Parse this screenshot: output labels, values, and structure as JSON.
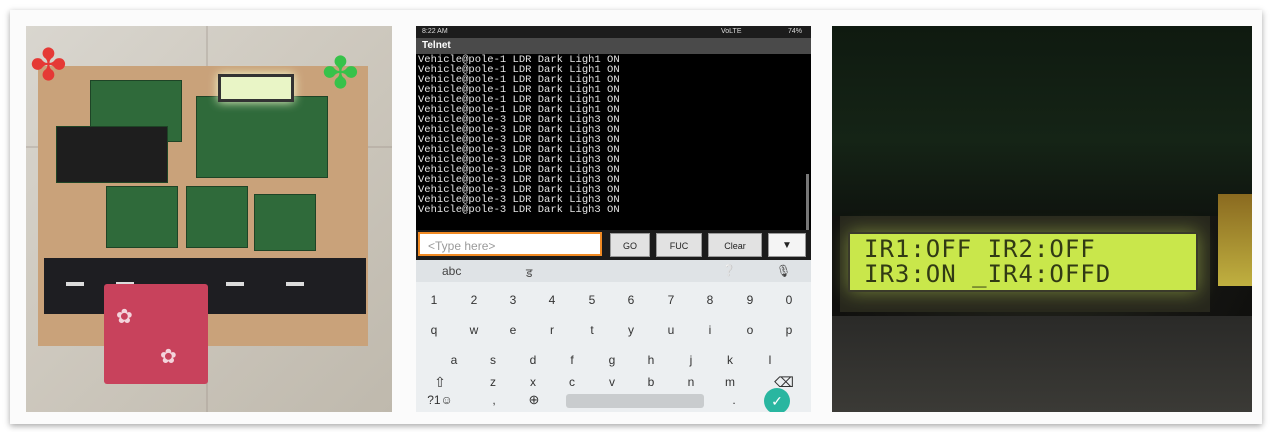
{
  "phone": {
    "status": {
      "time": "8:22 AM",
      "network": "VoLTE",
      "battery": "74%"
    },
    "app_title": "Telnet",
    "console_lines": [
      "Vehicle@pole-1 LDR Dark Ligh1 ON",
      "Vehicle@pole-1 LDR Dark Ligh1 ON",
      "Vehicle@pole-1 LDR Dark Ligh1 ON",
      "Vehicle@pole-1 LDR Dark Ligh1 ON",
      "Vehicle@pole-1 LDR Dark Ligh1 ON",
      "Vehicle@pole-1 LDR Dark Ligh1 ON",
      "Vehicle@pole-3 LDR Dark Ligh3 ON",
      "Vehicle@pole-3 LDR Dark Ligh3 ON",
      "Vehicle@pole-3 LDR Dark Ligh3 ON",
      "Vehicle@pole-3 LDR Dark Ligh3 ON",
      "Vehicle@pole-3 LDR Dark Ligh3 ON",
      "Vehicle@pole-3 LDR Dark Ligh3 ON",
      "Vehicle@pole-3 LDR Dark Ligh3 ON",
      "Vehicle@pole-3 LDR Dark Ligh3 ON",
      "Vehicle@pole-3 LDR Dark Ligh3 ON",
      "Vehicle@pole-3 LDR Dark Ligh3 ON"
    ],
    "input_placeholder": "<Type here>",
    "buttons": {
      "go": "GO",
      "fuc": "FUC",
      "clear": "Clear",
      "menu_icon": "chevron-down-icon"
    },
    "keyboard": {
      "top": {
        "abc": "abc",
        "handwriting": "ड"
      },
      "numbers": [
        "1",
        "2",
        "3",
        "4",
        "5",
        "6",
        "7",
        "8",
        "9",
        "0"
      ],
      "row1": [
        "q",
        "w",
        "e",
        "r",
        "t",
        "y",
        "u",
        "i",
        "o",
        "p"
      ],
      "row2": [
        "a",
        "s",
        "d",
        "f",
        "g",
        "h",
        "j",
        "k",
        "l"
      ],
      "row3": [
        "z",
        "x",
        "c",
        "v",
        "b",
        "n",
        "m"
      ],
      "symbols": "?1☺",
      "comma": ",",
      "period": "."
    }
  },
  "lcd": {
    "line1": "IR1:OFF IR2:OFF",
    "line2": "IR3:ON _IR4:OFFD"
  },
  "colors": {
    "lcd_green": "#c9e74b",
    "input_border": "#f08a24",
    "done_key": "#29b6a0",
    "pcb_green": "#2f6a3a"
  }
}
